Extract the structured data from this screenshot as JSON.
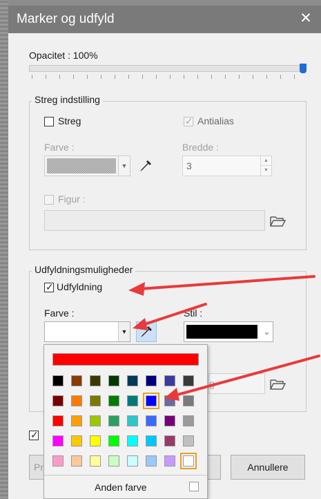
{
  "dialog": {
    "title": "Marker og udfyld",
    "close_glyph": "✕"
  },
  "opacity": {
    "label": "Opacitet : 100%",
    "value_percent": 100
  },
  "stroke_settings": {
    "title": "Streg indstilling",
    "stroke_label": "Streg",
    "stroke_checked": false,
    "antialias_label": "Antialias",
    "antialias_checked": true,
    "color_label": "Farve :",
    "width_label": "Bredde :",
    "width_value": "3",
    "shape_label": "Figur :",
    "shape_checked": false
  },
  "fill_options": {
    "title": "Udfyldningsmuligheder",
    "fill_label": "Udfyldning",
    "fill_checked": true,
    "color_label": "Farve :",
    "style_label": "Stil :",
    "style_color": "#000000",
    "partial_text": "g"
  },
  "color_popup": {
    "top_color": "#ff0000",
    "grid": [
      [
        "#000000",
        "#8a3a00",
        "#3a3a00",
        "#003a00",
        "#003a5a",
        "#00007a",
        "#3a3aa0",
        "#3a3a3a"
      ],
      [
        "#7a0000",
        "#ff7a00",
        "#7a7a00",
        "#007a00",
        "#007a7a",
        "#0000ff",
        "#6a6aa0",
        "#7a7a7a"
      ],
      [
        "#ff0000",
        "#ffa000",
        "#9ac800",
        "#2aa060",
        "#2ac8c8",
        "#3a6aff",
        "#7a007a",
        "#9a9a9a"
      ],
      [
        "#ff00ff",
        "#ffc800",
        "#ffff00",
        "#00ff00",
        "#00ffff",
        "#00c8ff",
        "#9a3a6a",
        "#c0c0c0"
      ],
      [
        "#ff9ac8",
        "#ffc89a",
        "#ffff9a",
        "#c8ffc8",
        "#c8ffff",
        "#9ac8ff",
        "#c89aff",
        "#ffffff"
      ]
    ],
    "selected": [
      [
        1,
        5
      ],
      [
        4,
        7
      ]
    ],
    "other_color_label": "Anden farve"
  },
  "footer": {
    "left_partial": "Pr",
    "cancel_label": "Annullere"
  },
  "colors": {
    "accent": "#1e6bd6",
    "annotation_arrow": "#e83a3a"
  }
}
